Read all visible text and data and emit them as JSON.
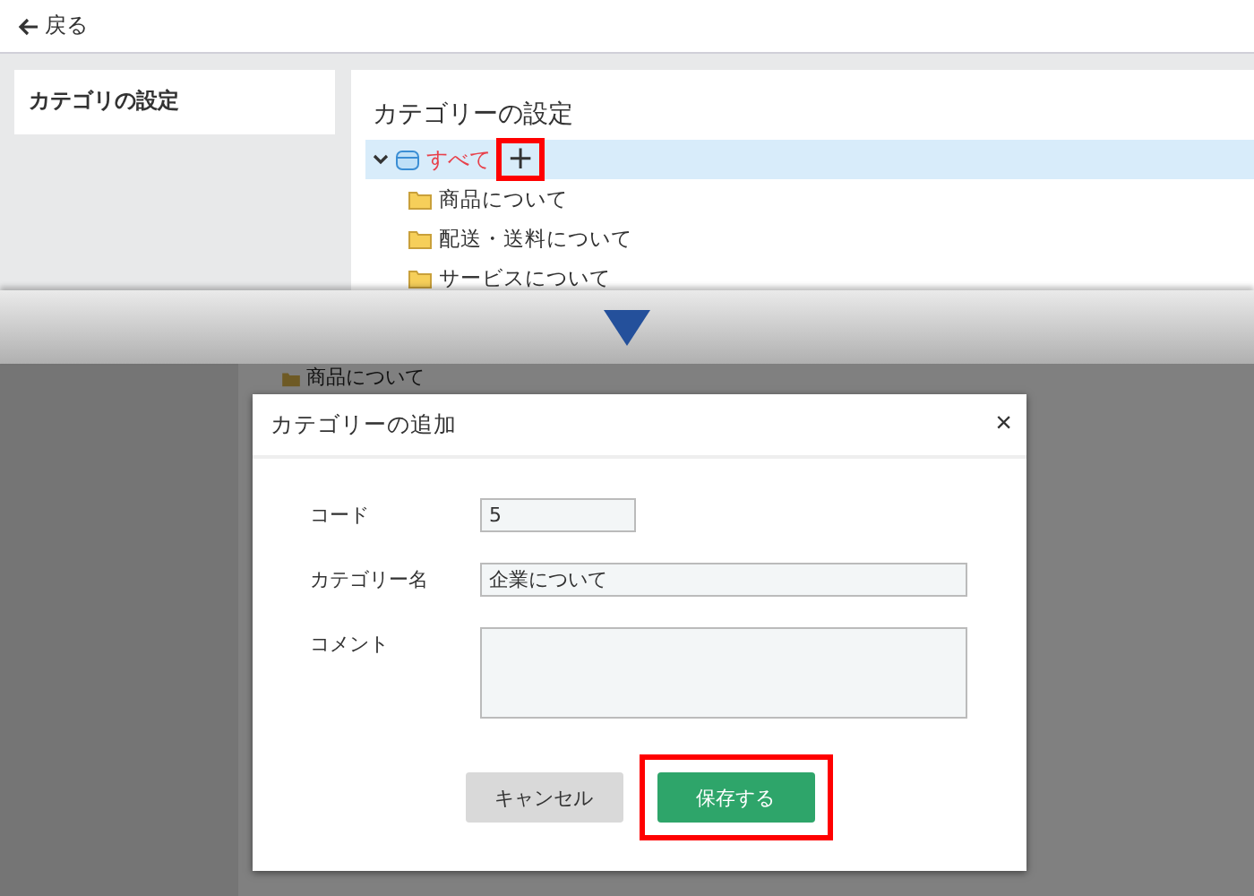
{
  "header": {
    "back_link": "戻る"
  },
  "sidebar": {
    "title": "カテゴリの設定"
  },
  "panel": {
    "title": "カテゴリーの設定",
    "tree": [
      {
        "label": "すべて",
        "expanded": true,
        "selected": true,
        "add_button": {
          "label": "+",
          "highlighted": true
        },
        "children": [
          {
            "label": "商品について"
          },
          {
            "label": "配送・送料について"
          },
          {
            "label": "サービスについて"
          }
        ]
      }
    ]
  },
  "background_tree": [
    {
      "label": "商品について"
    }
  ],
  "dialog": {
    "title": "カテゴリーの追加",
    "close": "×",
    "fields": [
      {
        "label": "コード",
        "kind": "short",
        "value": "5"
      },
      {
        "label": "カテゴリー名",
        "kind": "text",
        "value": "企業について"
      },
      {
        "label": "コメント",
        "kind": "textarea"
      }
    ],
    "buttons": [
      {
        "label": "キャンセル",
        "kind": "secondary",
        "highlighted": false
      },
      {
        "label": "保存する",
        "kind": "primary",
        "highlighted": true
      }
    ]
  }
}
